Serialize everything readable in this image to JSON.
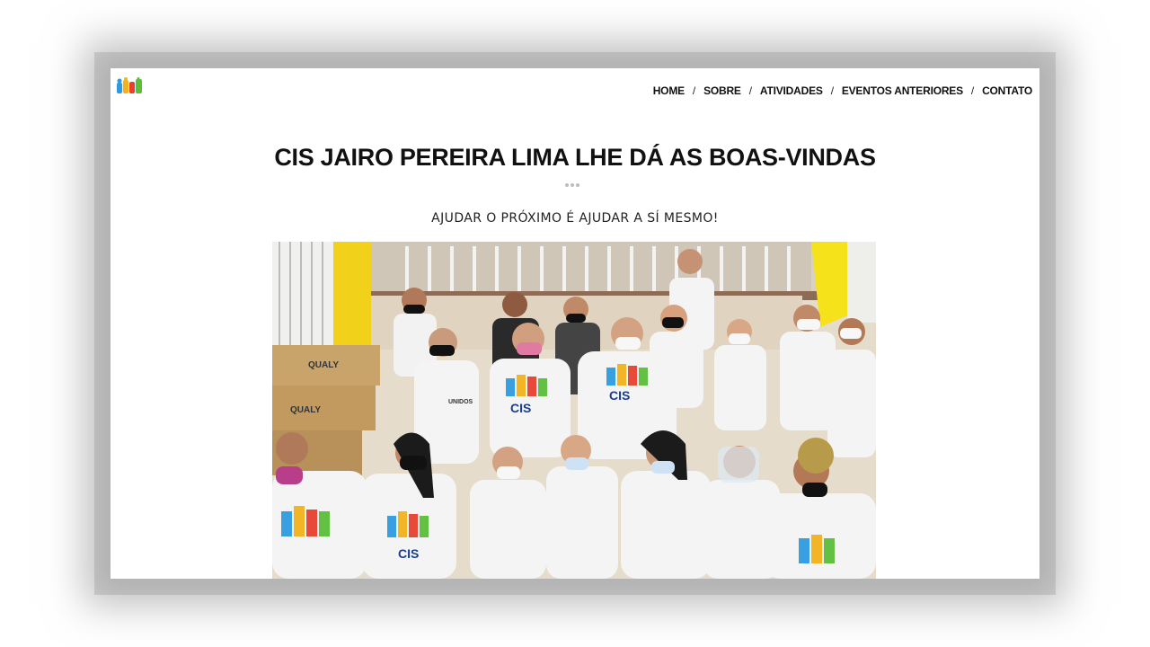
{
  "nav": {
    "items": [
      "HOME",
      "SOBRE",
      "ATIVIDADES",
      "EVENTOS ANTERIORES",
      "CONTATO"
    ],
    "separator": "/"
  },
  "hero": {
    "title": "CIS JAIRO PEREIRA LIMA LHE DÁ AS BOAS-VINDAS",
    "subtitle": "AJUDAR O PRÓXIMO É AJUDAR A SÍ MESMO!"
  },
  "photo": {
    "box_labels": [
      "QUALY",
      "QUALY"
    ],
    "shirt_labels": [
      "CIS",
      "UNIDOS CONTRA O TRABALHO INFANTIL"
    ]
  },
  "colors": {
    "text": "#111111",
    "wall_yellow": "#f2d11a",
    "shirt_white": "#f4f4f4"
  }
}
